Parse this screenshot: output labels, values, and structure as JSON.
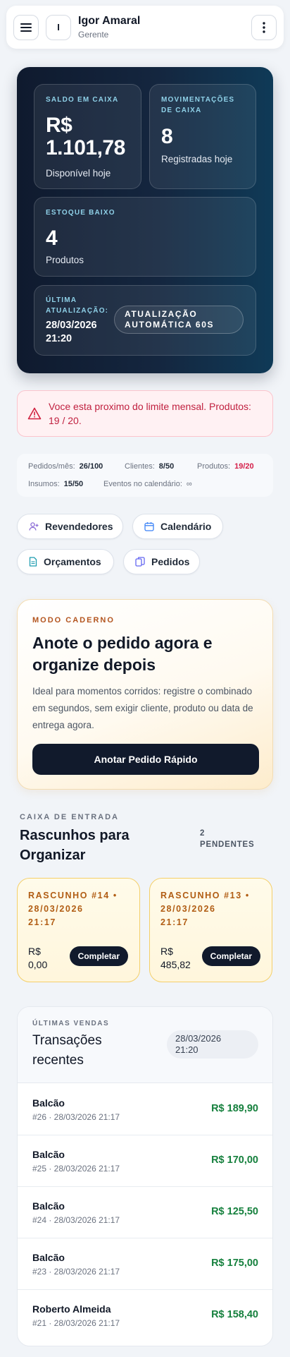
{
  "header": {
    "avatar_initial": "I",
    "user_name": "Igor Amaral",
    "user_role": "Gerente"
  },
  "dashboard": {
    "saldo": {
      "label": "SALDO EM CAIXA",
      "currency": "R$",
      "value": "1.101,78",
      "sub": "Disponível hoje"
    },
    "movimentacoes": {
      "label_line1": "MOVIMENTAÇÕES",
      "label_line2": "DE CAIXA",
      "value": "8",
      "sub": "Registradas hoje"
    },
    "estoque": {
      "label": "ESTOQUE BAIXO",
      "value": "4",
      "sub": "Produtos"
    },
    "atualizacao": {
      "label_line1": "ÚLTIMA",
      "label_line2": "ATUALIZAÇÃO:",
      "date": "28/03/2026",
      "time": "21:20",
      "pill_line1": "ATUALIZAÇÃO",
      "pill_line2": "AUTOMÁTICA 60S"
    }
  },
  "alert": {
    "text": "Voce esta proximo do limite mensal. Produtos: 19 / 20."
  },
  "limits": {
    "pedidos": {
      "label": "Pedidos/mês:",
      "value": "26/100"
    },
    "clientes": {
      "label": "Clientes:",
      "value": "8/50"
    },
    "produtos": {
      "label": "Produtos:",
      "value": "19/20"
    },
    "insumos": {
      "label": "Insumos:",
      "value": "15/50"
    },
    "eventos": {
      "label": "Eventos no calendário:",
      "value": "∞"
    }
  },
  "quick_actions": {
    "revendedores": "Revendedores",
    "calendario": "Calendário",
    "orcamentos": "Orçamentos",
    "pedidos": "Pedidos"
  },
  "notebook": {
    "kicker": "MODO CADERNO",
    "title": "Anote o pedido agora e organize depois",
    "description": "Ideal para momentos corridos: registre o combinado em segundos, sem exigir cliente, produto ou data de entrega agora.",
    "button": "Anotar Pedido Rápido"
  },
  "inbox": {
    "kicker": "CAIXA DE ENTRADA",
    "title": "Rascunhos para Organizar",
    "count_line1": "2",
    "count_line2": "PENDENTES",
    "drafts": [
      {
        "head_line1": "RASCUNHO #14 •",
        "head_line2": "28/03/2026",
        "head_line3": "21:17",
        "currency": "R$",
        "value": "0,00",
        "button": "Completar"
      },
      {
        "head_line1": "RASCUNHO #13 •",
        "head_line2": "28/03/2026",
        "head_line3": "21:17",
        "currency": "R$",
        "value": "485,82",
        "button": "Completar"
      }
    ]
  },
  "sales": {
    "kicker": "ÚLTIMAS VENDAS",
    "title": "Transações recentes",
    "date_line1": "28/03/2026",
    "date_line2": "21:20",
    "rows": [
      {
        "name": "Balcão",
        "sub": "#26 · 28/03/2026 21:17",
        "amount": "R$ 189,90"
      },
      {
        "name": "Balcão",
        "sub": "#25 · 28/03/2026 21:17",
        "amount": "R$ 170,00"
      },
      {
        "name": "Balcão",
        "sub": "#24 · 28/03/2026 21:17",
        "amount": "R$ 125,50"
      },
      {
        "name": "Balcão",
        "sub": "#23 · 28/03/2026 21:17",
        "amount": "R$ 175,00"
      },
      {
        "name": "Roberto Almeida",
        "sub": "#21 · 28/03/2026 21:17",
        "amount": "R$ 158,40"
      }
    ]
  }
}
